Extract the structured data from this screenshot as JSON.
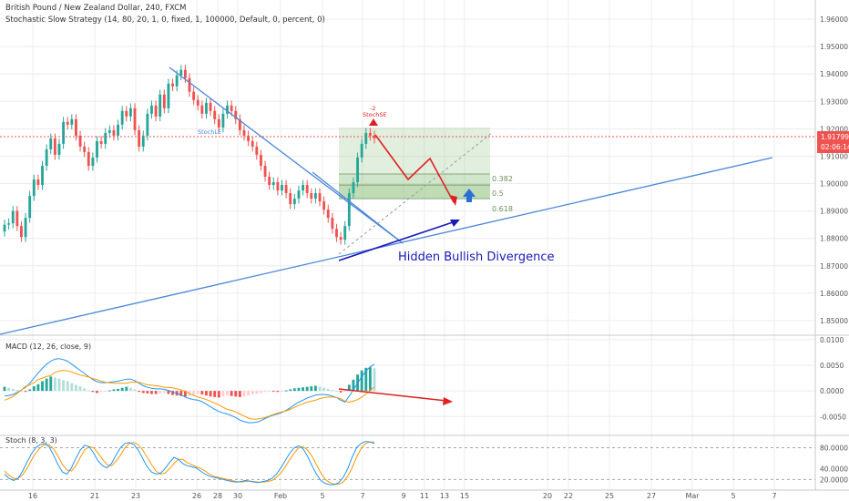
{
  "header": {
    "symbol": "British Pound / New Zealand Dollar, 240, FXCM",
    "strategy": "Stochastic Slow Strategy (14, 80, 20, 1, 0, fixed, 1, 100000, Default, 0, percent, 0)"
  },
  "colors": {
    "bull": "#26a69a",
    "bear": "#ef5350",
    "trendline": "#4a86d8",
    "divergence": "#1a1ab8",
    "annotation_red": "#e02020",
    "price_line": "#ef5350",
    "fib_zone": "#8ac07a",
    "macd_line": "#2196f3",
    "signal_line": "#ff9800",
    "stoch_k": "#2196f3",
    "stoch_d": "#ff9800",
    "arrow_blue": "#2b6fd6"
  },
  "chart_data": [
    {
      "type": "candlestick",
      "name": "price",
      "ylim": [
        1.845,
        1.967
      ],
      "y_ticks": [
        "1.96000",
        "1.95000",
        "1.94000",
        "1.93000",
        "1.92000",
        "1.91000",
        "1.90000",
        "1.89000",
        "1.88000",
        "1.87000",
        "1.86000",
        "1.85000"
      ],
      "x_ticks": [
        "16",
        "21",
        "23",
        "26",
        "28",
        "30",
        "Feb",
        "5",
        "7",
        "9",
        "11",
        "13",
        "15",
        "20",
        "22",
        "25",
        "27",
        "Mar",
        "5",
        "7"
      ],
      "last_price": "1.91799",
      "countdown": "02:06:14",
      "close": [
        1.885,
        1.8855,
        1.89,
        1.8845,
        1.8805,
        1.8875,
        1.8955,
        1.9015,
        1.8995,
        1.9065,
        1.9125,
        1.9165,
        1.9105,
        1.9145,
        1.9225,
        1.9215,
        1.9235,
        1.9175,
        1.9135,
        1.9115,
        1.9065,
        1.9095,
        1.9155,
        1.9145,
        1.9185,
        1.9195,
        1.9175,
        1.9215,
        1.9265,
        1.9245,
        1.9275,
        1.9195,
        1.9135,
        1.9175,
        1.9255,
        1.9285,
        1.9245,
        1.9325,
        1.9275,
        1.9365,
        1.9355,
        1.9395,
        1.9415,
        1.9385,
        1.9335,
        1.9305,
        1.9285,
        1.9255,
        1.9295,
        1.9265,
        1.9235,
        1.9205,
        1.9255,
        1.9285,
        1.9265,
        1.9235,
        1.9195,
        1.9175,
        1.9155,
        1.9135,
        1.9105,
        1.9065,
        1.9025,
        1.8995,
        1.9005,
        1.8975,
        1.8995,
        1.8965,
        1.8925,
        1.8945,
        1.8975,
        1.8995,
        1.8965,
        1.8945,
        1.8965,
        1.8935,
        1.8905,
        1.8875,
        1.8835,
        1.8805,
        1.8795,
        1.8845,
        1.8965,
        1.9005,
        1.9095,
        1.9145,
        1.9185,
        1.9175,
        1.9165
      ],
      "ohlc_source": "estimated from image"
    },
    {
      "type": "annotations",
      "fib_levels": [
        {
          "label": "0.382",
          "value": 1.9035
        },
        {
          "label": "0.5",
          "value": 1.8995
        },
        {
          "label": "0.618",
          "value": 1.8945
        }
      ],
      "signals": [
        {
          "label": "StochLE"
        },
        {
          "label": "StochSE",
          "qty": "-2"
        }
      ],
      "divergence_label": "Hidden Bullish Divergence"
    },
    {
      "type": "macd",
      "name": "MACD (12, 26, close, 9)",
      "ylim": [
        -0.0085,
        0.0105
      ],
      "y_ticks": [
        "0.0100",
        "0.0050",
        "0.0000",
        "-0.0050"
      ],
      "histogram": [
        0.0008,
        0.0006,
        0.0004,
        0.0002,
        0.0,
        -0.0002,
        0.0003,
        0.0009,
        0.0013,
        0.0019,
        0.0024,
        0.0028,
        0.0026,
        0.0024,
        0.0021,
        0.0019,
        0.0015,
        0.0012,
        0.0009,
        0.0005,
        0.0001,
        -0.0002,
        -0.0004,
        -0.0003,
        -0.0001,
        0.0001,
        0.0003,
        0.0004,
        0.0006,
        0.0008,
        0.0006,
        0.0003,
        -0.0002,
        -0.0004,
        -0.0005,
        -0.0006,
        -0.0006,
        -0.0005,
        -0.0004,
        -0.0006,
        -0.0008,
        -0.0009,
        -0.001,
        -0.0011,
        -0.001,
        -0.0008,
        -0.0006,
        -0.0007,
        -0.0009,
        -0.0011,
        -0.0012,
        -0.0013,
        -0.0011,
        -0.0009,
        -0.001,
        -0.0011,
        -0.0012,
        -0.0011,
        -0.0009,
        -0.0007,
        -0.0006,
        -0.0004,
        -0.0002,
        -0.0001,
        -0.0001,
        -0.0002,
        -0.0001,
        0.0001,
        0.0003,
        0.0005,
        0.0006,
        0.0007,
        0.0008,
        0.0009,
        0.001,
        0.0008,
        0.0006,
        0.0004,
        0.0002,
        0.0,
        -0.0003,
        -0.0002,
        0.0012,
        0.0022,
        0.0032,
        0.004,
        0.0045,
        0.0046,
        0.0044
      ],
      "macd": [
        -0.001,
        -0.0009,
        -0.0007,
        -0.0003,
        0.0002,
        0.0007,
        0.0015,
        0.0025,
        0.0035,
        0.0044,
        0.0052,
        0.0058,
        0.0062,
        0.0063,
        0.0061,
        0.0058,
        0.0052,
        0.0046,
        0.004,
        0.0034,
        0.0028,
        0.0022,
        0.0018,
        0.0016,
        0.0016,
        0.0017,
        0.0018,
        0.0019,
        0.0021,
        0.0023,
        0.0023,
        0.002,
        0.0015,
        0.001,
        0.0007,
        0.0005,
        0.0004,
        0.0004,
        0.0003,
        0.0001,
        -0.0002,
        -0.0005,
        -0.0008,
        -0.0012,
        -0.0015,
        -0.0017,
        -0.0018,
        -0.0021,
        -0.0026,
        -0.0031,
        -0.0036,
        -0.004,
        -0.0043,
        -0.0045,
        -0.0048,
        -0.0052,
        -0.0057,
        -0.006,
        -0.0062,
        -0.0062,
        -0.0061,
        -0.0058,
        -0.0054,
        -0.005,
        -0.0047,
        -0.0045,
        -0.0042,
        -0.0038,
        -0.0033,
        -0.0027,
        -0.0022,
        -0.0018,
        -0.0014,
        -0.0011,
        -0.0008,
        -0.0007,
        -0.0007,
        -0.0008,
        -0.001,
        -0.0013,
        -0.0018,
        -0.0022,
        -0.001,
        0.0002,
        0.0015,
        0.0028,
        0.0039,
        0.0047,
        0.0052
      ],
      "signal": [
        -0.0018,
        -0.0015,
        -0.0011,
        -0.0005,
        0.0002,
        0.0009,
        0.0012,
        0.0016,
        0.0022,
        0.0025,
        0.0028,
        0.003,
        0.0036,
        0.0039,
        0.004,
        0.0039,
        0.0037,
        0.0034,
        0.0031,
        0.0029,
        0.0027,
        0.0024,
        0.0022,
        0.0019,
        0.0017,
        0.0016,
        0.0015,
        0.0015,
        0.0015,
        0.0015,
        0.0017,
        0.0017,
        0.0017,
        0.0014,
        0.0012,
        0.0011,
        0.001,
        0.0009,
        0.0007,
        0.0007,
        0.0006,
        0.0004,
        0.0002,
        -0.0001,
        -0.0005,
        -0.0009,
        -0.0012,
        -0.0014,
        -0.0017,
        -0.002,
        -0.0024,
        -0.0027,
        -0.0032,
        -0.0036,
        -0.0038,
        -0.0041,
        -0.0045,
        -0.0049,
        -0.0053,
        -0.0055,
        -0.0055,
        -0.0054,
        -0.0052,
        -0.0049,
        -0.0046,
        -0.0043,
        -0.0041,
        -0.0039,
        -0.0036,
        -0.0032,
        -0.0028,
        -0.0025,
        -0.0022,
        -0.002,
        -0.0018,
        -0.0015,
        -0.0013,
        -0.0012,
        -0.0012,
        -0.0013,
        -0.0015,
        -0.002,
        -0.0022,
        -0.002,
        -0.0017,
        -0.0012,
        -0.0006,
        0.0001,
        0.0008
      ]
    },
    {
      "type": "stochastic",
      "name": "Stoch (8, 3, 3)",
      "ylim": [
        5,
        100
      ],
      "y_ticks": [
        "80.0000",
        "40.0000",
        "20.0000"
      ],
      "overbought": 80,
      "oversold": 20,
      "k": [
        30,
        22,
        18,
        22,
        35,
        52,
        68,
        80,
        86,
        88,
        82,
        66,
        48,
        34,
        30,
        42,
        60,
        76,
        85,
        82,
        70,
        55,
        46,
        42,
        50,
        66,
        80,
        88,
        90,
        86,
        76,
        60,
        44,
        34,
        30,
        32,
        40,
        52,
        62,
        58,
        50,
        46,
        44,
        42,
        36,
        30,
        26,
        24,
        22,
        20,
        18,
        16,
        15,
        16,
        18,
        17,
        15,
        14,
        16,
        18,
        22,
        30,
        42,
        56,
        70,
        80,
        84,
        78,
        64,
        46,
        30,
        18,
        12,
        10,
        10,
        14,
        24,
        40,
        62,
        80,
        88,
        92,
        91,
        88
      ],
      "d": [
        36,
        28,
        22,
        22,
        28,
        40,
        56,
        70,
        80,
        86,
        86,
        78,
        64,
        48,
        38,
        36,
        46,
        62,
        76,
        82,
        80,
        70,
        58,
        48,
        46,
        54,
        66,
        80,
        88,
        90,
        86,
        76,
        62,
        48,
        36,
        30,
        32,
        40,
        50,
        58,
        58,
        52,
        48,
        44,
        41,
        36,
        30,
        26,
        24,
        22,
        20,
        18,
        16,
        15,
        16,
        17,
        16,
        15,
        15,
        16,
        18,
        24,
        32,
        44,
        58,
        70,
        80,
        82,
        76,
        64,
        48,
        32,
        20,
        14,
        11,
        11,
        15,
        26,
        42,
        62,
        78,
        88,
        91,
        91
      ]
    }
  ]
}
